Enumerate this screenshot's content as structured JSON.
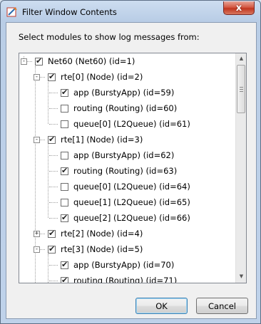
{
  "window": {
    "title": "Filter Window Contents",
    "close_label": "x"
  },
  "prompt": "Select modules to show log messages from:",
  "tree": [
    {
      "level": 0,
      "exp": "-",
      "checked": true,
      "label": "Net60 (Net60) (id=1)"
    },
    {
      "level": 1,
      "exp": "-",
      "checked": true,
      "label": "rte[0] (Node) (id=2)"
    },
    {
      "level": 2,
      "exp": "",
      "checked": true,
      "label": "app (BurstyApp) (id=59)"
    },
    {
      "level": 2,
      "exp": "",
      "checked": false,
      "label": "routing (Routing) (id=60)"
    },
    {
      "level": 2,
      "exp": "",
      "checked": false,
      "label": "queue[0] (L2Queue) (id=61)"
    },
    {
      "level": 1,
      "exp": "-",
      "checked": true,
      "label": "rte[1] (Node) (id=3)"
    },
    {
      "level": 2,
      "exp": "",
      "checked": false,
      "label": "app (BurstyApp) (id=62)"
    },
    {
      "level": 2,
      "exp": "",
      "checked": true,
      "label": "routing (Routing) (id=63)"
    },
    {
      "level": 2,
      "exp": "",
      "checked": false,
      "label": "queue[0] (L2Queue) (id=64)"
    },
    {
      "level": 2,
      "exp": "",
      "checked": false,
      "label": "queue[1] (L2Queue) (id=65)"
    },
    {
      "level": 2,
      "exp": "",
      "checked": true,
      "label": "queue[2] (L2Queue) (id=66)"
    },
    {
      "level": 1,
      "exp": "+",
      "checked": true,
      "label": "rte[2] (Node) (id=4)"
    },
    {
      "level": 1,
      "exp": "-",
      "checked": true,
      "label": "rte[3] (Node) (id=5)"
    },
    {
      "level": 2,
      "exp": "",
      "checked": true,
      "label": "app (BurstyApp) (id=70)"
    },
    {
      "level": 2,
      "exp": "",
      "checked": true,
      "label": "routing (Routing) (id=71)"
    },
    {
      "level": 2,
      "exp": "",
      "checked": true,
      "label": ""
    }
  ],
  "buttons": {
    "ok": "OK",
    "cancel": "Cancel"
  },
  "colors": {
    "title_bar": "#b9cde6",
    "close_button": "#c1361f",
    "client_bg": "#f0f0f0",
    "default_button_border": "#3c7fb1"
  },
  "icons": {
    "app": "filter-window-app-icon",
    "close": "close-icon",
    "scroll_up": "scroll-up-arrow-icon",
    "scroll_down": "scroll-down-arrow-icon"
  }
}
